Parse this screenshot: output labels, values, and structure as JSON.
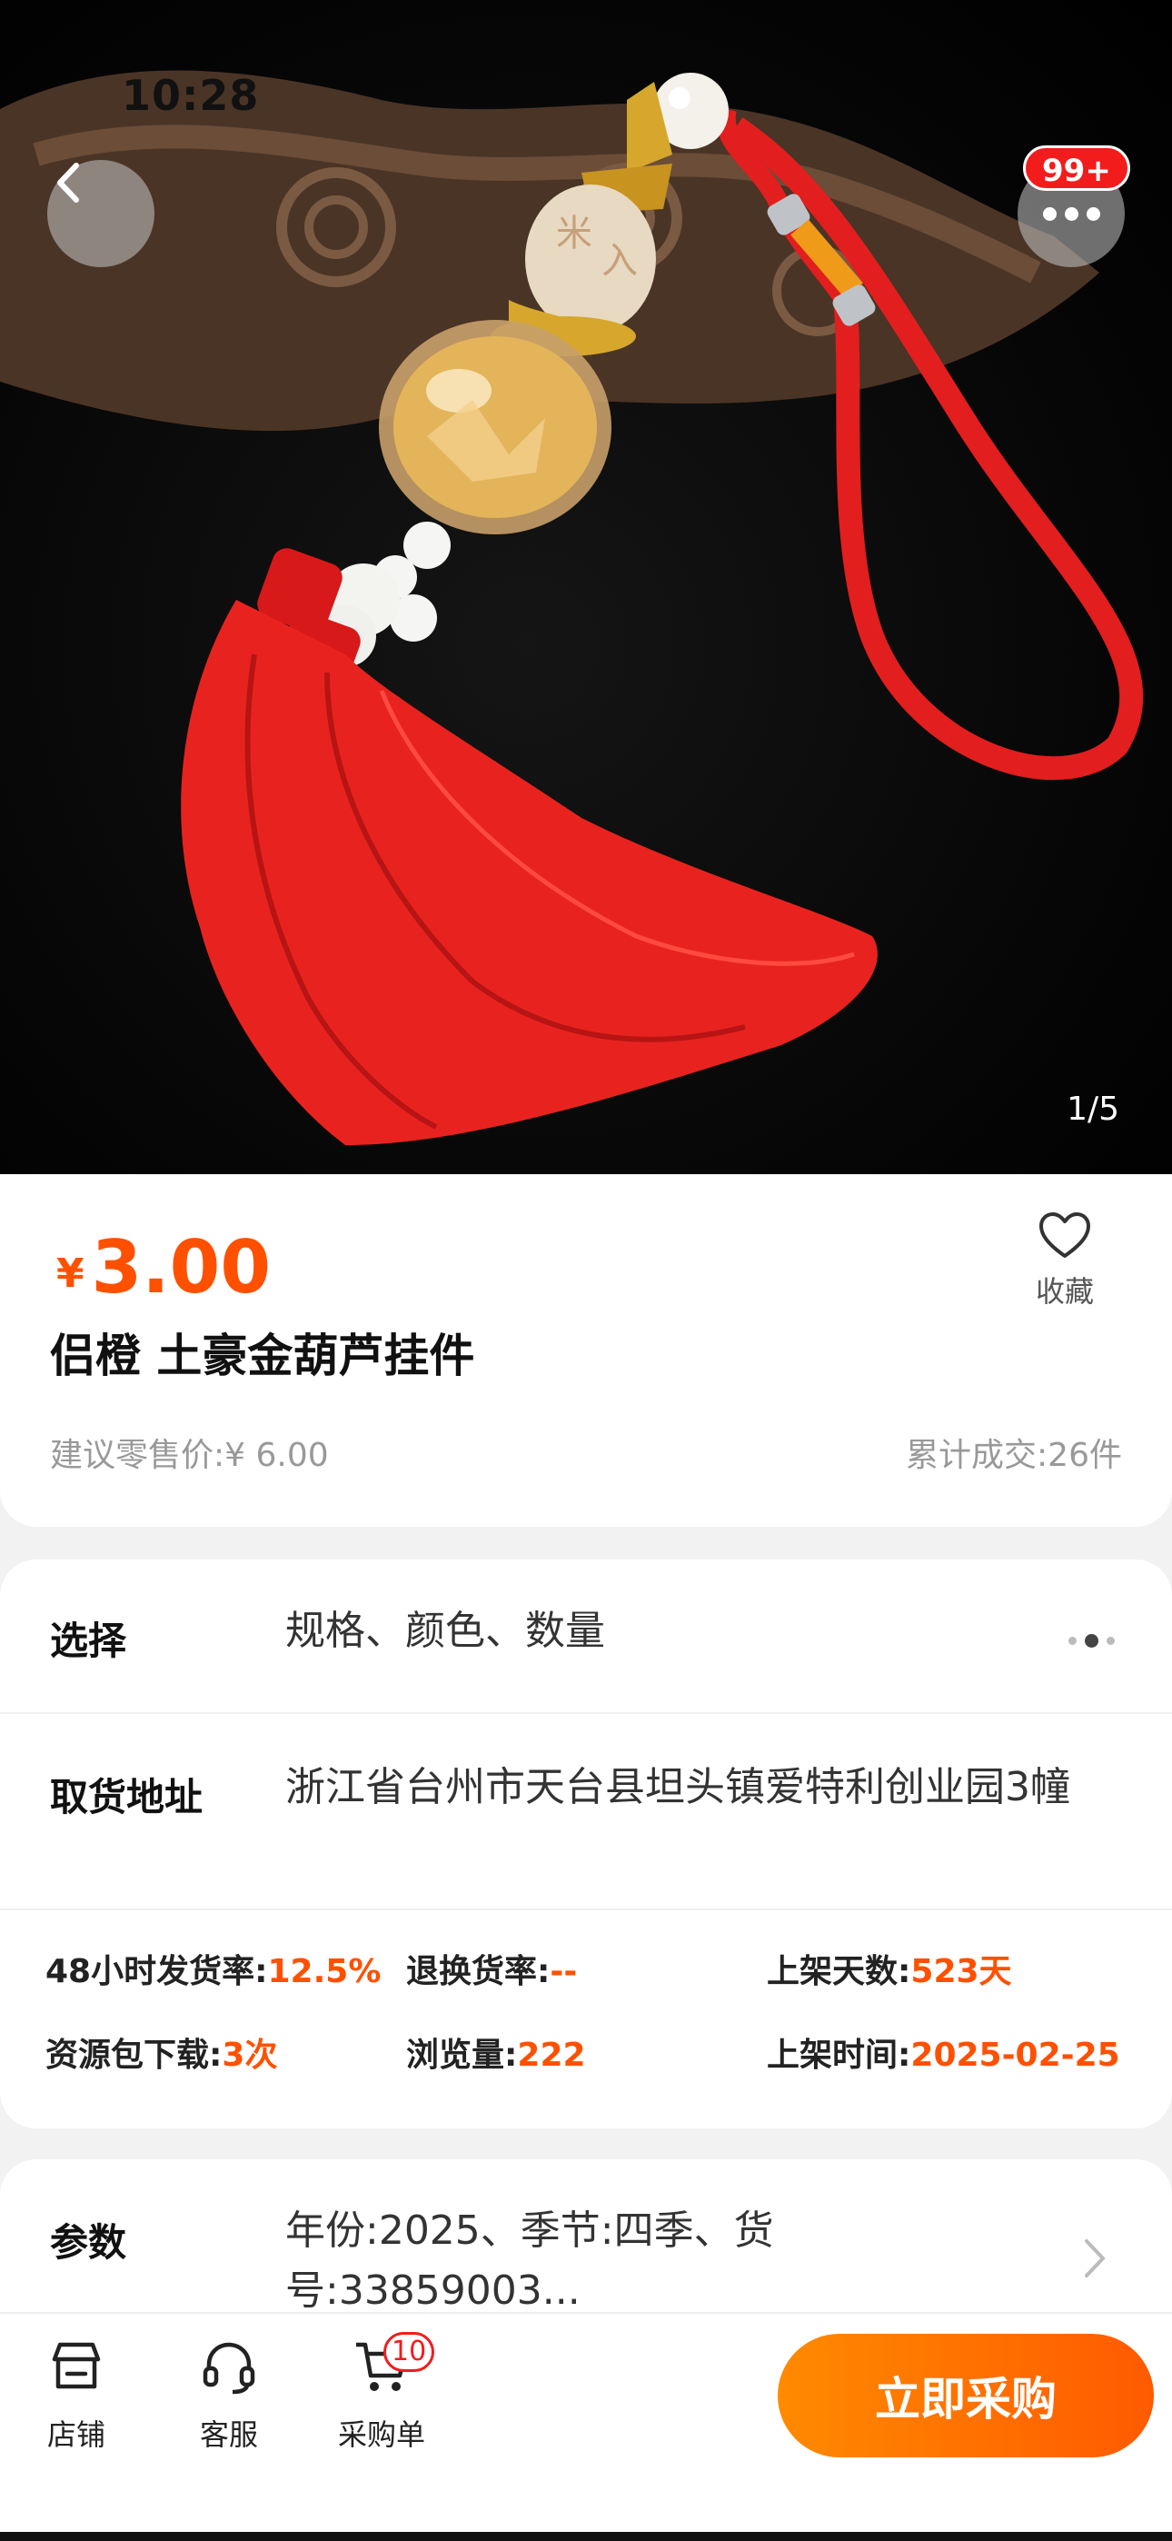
{
  "status_bar": {
    "time": "10:28"
  },
  "gallery": {
    "badge": "99+",
    "counter": "1/5"
  },
  "product": {
    "currency": "¥",
    "price": "3.00",
    "favorite_label": "收藏",
    "title": "侣橙 土豪金葫芦挂件",
    "retail_price": "建议零售价:¥ 6.00",
    "sold": "累计成交:26件"
  },
  "info": {
    "select_label": "选择",
    "select_value": "规格、颜色、数量",
    "address_label": "取货地址",
    "address_value": "浙江省台州市天台县坦头镇爱特利创业园3幢",
    "stats": [
      {
        "label": "48小时发货率:",
        "value": "12.5%"
      },
      {
        "label": "退换货率:",
        "value": "--"
      },
      {
        "label": "上架天数:",
        "value": "523天"
      },
      {
        "label": "资源包下载:",
        "value": "3次"
      },
      {
        "label": "浏览量:",
        "value": "222"
      },
      {
        "label": "上架时间:",
        "value": "2025-02-25"
      }
    ]
  },
  "params": {
    "label": "参数",
    "value": "年份:2025、季节:四季、货号:33859003..."
  },
  "bottom_bar": {
    "shop_label": "店铺",
    "service_label": "客服",
    "cart_label": "采购单",
    "cart_count": "10",
    "buy_label": "立即采购"
  },
  "icons": {
    "back": "chevron-left-icon",
    "more": "more-dots-icon",
    "favorite": "heart-outline-icon",
    "shop": "store-icon",
    "service": "headset-icon",
    "cart": "cart-icon",
    "params_arrow": "chevron-right-icon"
  },
  "colors": {
    "accent": "#ff5000",
    "badge": "#f21c1c",
    "button_gradient_start": "#ff8a00",
    "button_gradient_end": "#ff5a00"
  }
}
